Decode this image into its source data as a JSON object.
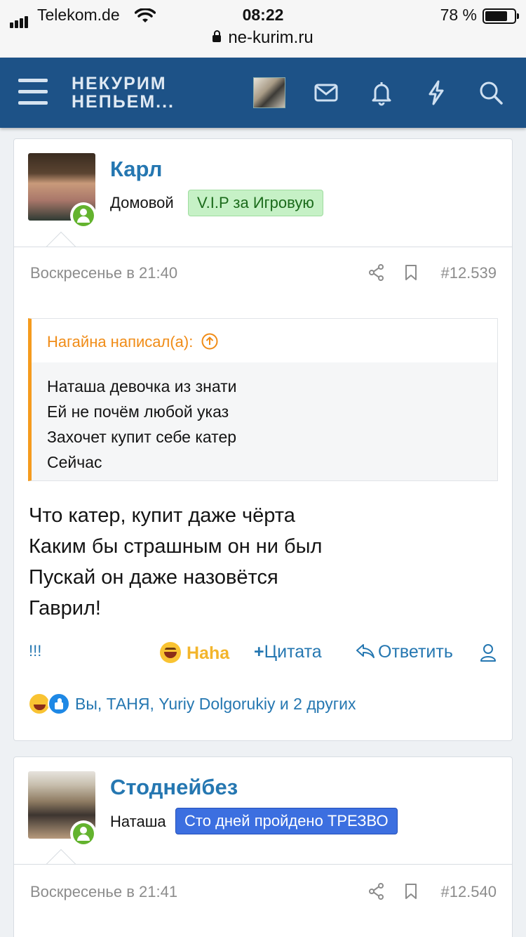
{
  "status_bar": {
    "carrier": "Telekom.de",
    "time": "08:22",
    "battery_percent": "78 %",
    "battery_level": 0.78
  },
  "url_bar": {
    "domain": "ne-kurim.ru"
  },
  "navbar": {
    "logo_line1": "НЕКУРИМ",
    "logo_line2": "НЕПЬЕМ...",
    "icons": [
      "menu-icon",
      "user-avatar",
      "envelope-icon",
      "bell-icon",
      "bolt-icon",
      "search-icon"
    ],
    "background": "#1d5287"
  },
  "posts": [
    {
      "username": "Карл",
      "user_title": "Домовой",
      "banner": "V.I.P за Игровую",
      "banner_bg": "#c6f1c6",
      "date": "Воскресенье в 21:40",
      "post_number": "#12.539",
      "quote": {
        "author": "Нагайна написал(а):",
        "lines": [
          "Наташа девочка из знати",
          "Ей не почём любой указ",
          "Захочет купит себе катер",
          "Сейчас"
        ]
      },
      "message_lines": [
        "Что катер, купит даже чёрта",
        "Каким бы страшным он ни был",
        "Пускай он даже назовётся",
        "Гаврил!"
      ],
      "actions": {
        "report": "!!!",
        "reaction": "Haha",
        "quote": "Цитата",
        "reply": "Ответить"
      },
      "reactions_summary": "Вы, ТАНЯ, Yuriy Dolgorukiy и 2 других"
    },
    {
      "username": "Стоднейбез",
      "user_title": "Наташа",
      "banner": "Сто дней пройдено ТРЕЗВО",
      "banner_bg": "#3c6fe0",
      "date": "Воскресенье в 21:41",
      "post_number": "#12.540"
    }
  ]
}
